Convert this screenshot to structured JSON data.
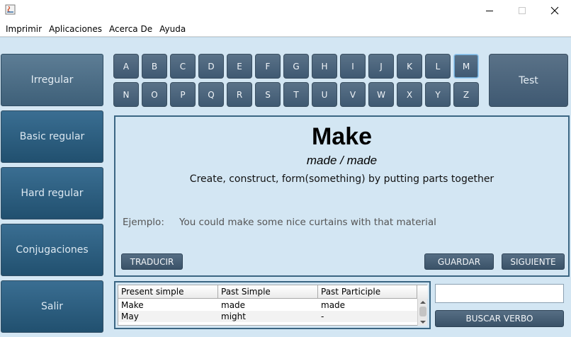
{
  "menu": [
    "Imprimir",
    "Aplicaciones",
    "Acerca De",
    "Ayuda"
  ],
  "sidebar": [
    {
      "label": "Irregular",
      "active": true
    },
    {
      "label": "Basic regular",
      "active": false
    },
    {
      "label": "Hard regular",
      "active": false
    },
    {
      "label": "Conjugaciones",
      "active": false
    },
    {
      "label": "Salir",
      "active": false
    }
  ],
  "letters_row1": [
    "A",
    "B",
    "C",
    "D",
    "E",
    "F",
    "G",
    "H",
    "I",
    "J",
    "K",
    "L",
    "M"
  ],
  "letters_row2": [
    "N",
    "O",
    "P",
    "Q",
    "R",
    "S",
    "T",
    "U",
    "V",
    "W",
    "X",
    "Y",
    "Z"
  ],
  "selected_letter": "M",
  "test_label": "Test",
  "verb": {
    "title": "Make",
    "forms": "made / made",
    "meaning": "Create, construct, form(something) by putting parts together",
    "example_label": "Ejemplo:",
    "example": "You could make some nice curtains with that material"
  },
  "buttons": {
    "translate": "TRADUCIR",
    "save": "GUARDAR",
    "next": "SIGUIENTE",
    "search": "BUSCAR VERBO"
  },
  "table": {
    "headers": [
      "Present simple",
      "Past Simple",
      "Past Participle"
    ],
    "rows": [
      [
        "Make",
        "made",
        "made"
      ],
      [
        "May",
        "might",
        "-"
      ]
    ]
  },
  "search": {
    "value": ""
  },
  "colors": {
    "accent": "#21506f",
    "background": "#d3e6f3",
    "button": "#4a6379"
  }
}
